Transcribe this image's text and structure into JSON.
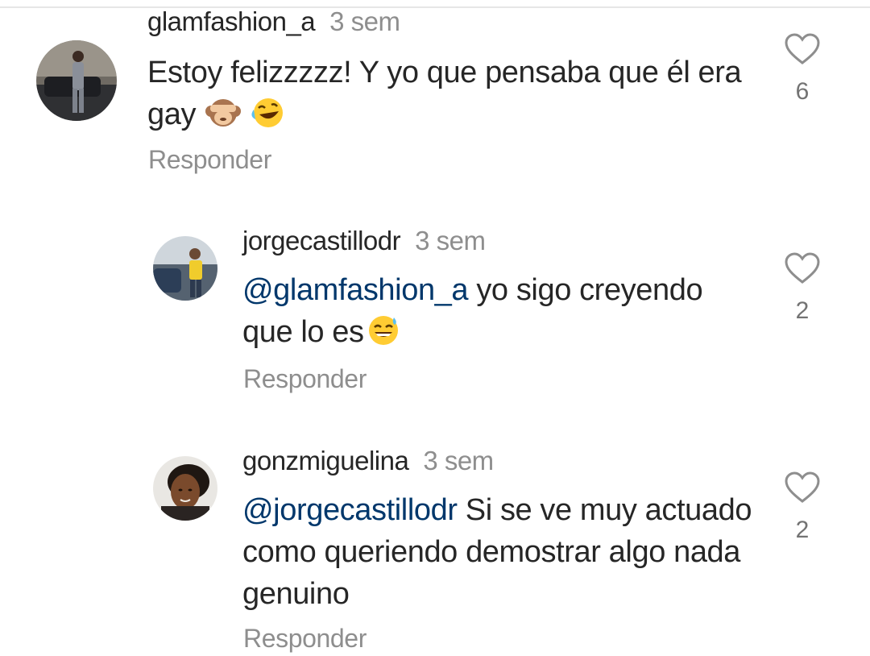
{
  "comments": [
    {
      "username": "glamfashion_a",
      "time": "3 sem",
      "text": "Estoy felizzzzz! Y yo que pensaba que él era gay",
      "likes": "6",
      "reply_label": "Responder",
      "emojis": [
        "see-no-evil-monkey-icon",
        "rolling-laughing-icon"
      ]
    },
    {
      "username": "jorgecastillodr",
      "time": "3 sem",
      "mention": "@glamfashion_a",
      "text": "yo sigo creyendo que lo es",
      "likes": "2",
      "reply_label": "Responder",
      "emojis": [
        "sweat-smile-icon"
      ]
    },
    {
      "username": "gonzmiguelina",
      "time": "3 sem",
      "mention": "@jorgecastillodr",
      "text": "Si se ve muy actuado como queriendo demostrar algo nada genuino",
      "likes": "2",
      "reply_label": "Responder"
    }
  ],
  "colors": {
    "text": "#262626",
    "secondary": "#8e8e8e",
    "mention": "#00376b",
    "emoji_face": "#ffcc33"
  }
}
